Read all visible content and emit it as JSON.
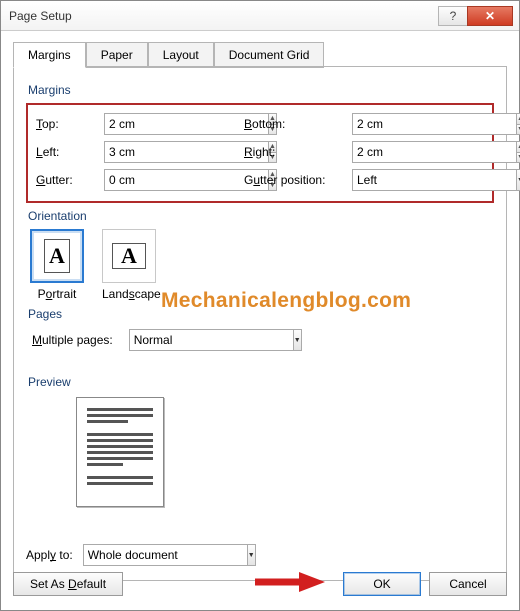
{
  "window": {
    "title": "Page Setup"
  },
  "tabs": [
    "Margins",
    "Paper",
    "Layout",
    "Document Grid"
  ],
  "margins": {
    "group_label": "Margins",
    "top_label": "Top:",
    "top_value": "2 cm",
    "bottom_label": "Bottom:",
    "bottom_value": "2 cm",
    "left_label": "Left:",
    "left_value": "3 cm",
    "right_label": "Right:",
    "right_value": "2 cm",
    "gutter_label": "Gutter:",
    "gutter_value": "0 cm",
    "gutter_pos_label": "Gutter position:",
    "gutter_pos_value": "Left"
  },
  "orientation": {
    "group_label": "Orientation",
    "portrait_label": "Portrait",
    "landscape_label": "Landscape",
    "selected": "portrait"
  },
  "pages": {
    "group_label": "Pages",
    "multiple_label": "Multiple pages:",
    "multiple_value": "Normal"
  },
  "preview": {
    "group_label": "Preview"
  },
  "apply": {
    "label": "Apply to:",
    "value": "Whole document"
  },
  "buttons": {
    "default": "Set As Default",
    "ok": "OK",
    "cancel": "Cancel"
  },
  "watermark": "Mechanicalengblog.com"
}
